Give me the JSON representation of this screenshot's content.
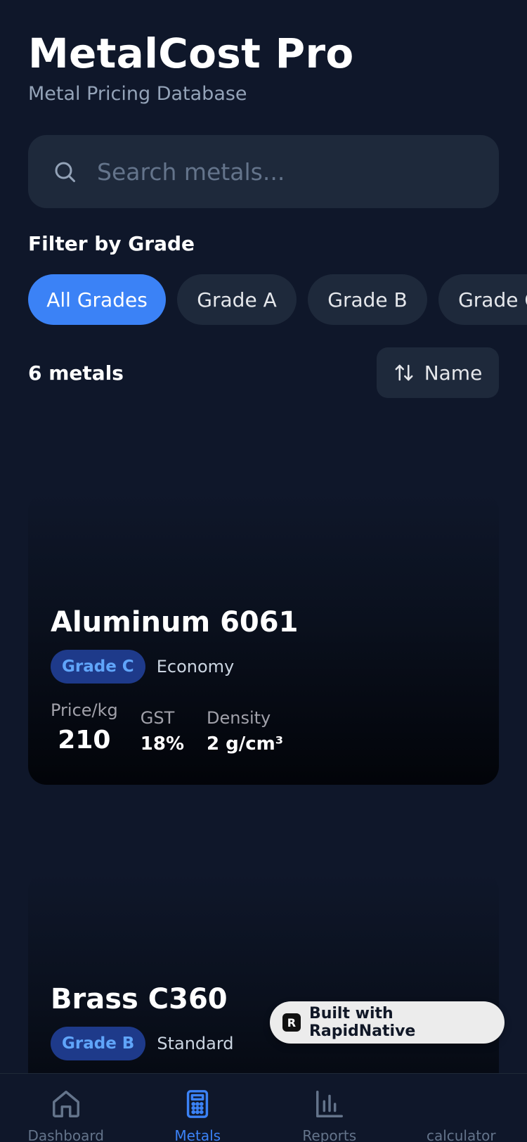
{
  "header": {
    "title": "MetalCost Pro",
    "subtitle": "Metal Pricing Database"
  },
  "search": {
    "placeholder": "Search metals...",
    "value": "",
    "icon": "search-icon"
  },
  "filter": {
    "label": "Filter by Grade",
    "chips": [
      "All Grades",
      "Grade A",
      "Grade B",
      "Grade C"
    ],
    "active": "All Grades"
  },
  "results": {
    "count": "6 metals",
    "sort_label": "Name",
    "sort_icon": "sort-arrows-icon"
  },
  "cards": [
    {
      "name": "Aluminum 6061",
      "grade": "Grade C",
      "tier": "Economy",
      "price_label": "Price/kg",
      "price": "210",
      "gst_label": "GST",
      "gst": "18%",
      "density_label": "Density",
      "density": "2 g/cm³"
    },
    {
      "name": "Brass C360",
      "grade": "Grade B",
      "tier": "Standard"
    }
  ],
  "badge": {
    "label": "Built with RapidNative",
    "logo": "R"
  },
  "tabs": [
    {
      "label": "Dashboard",
      "icon": "home-icon"
    },
    {
      "label": "Metals",
      "icon": "calculator-icon"
    },
    {
      "label": "Reports",
      "icon": "bar-chart-icon"
    },
    {
      "label": "calculator",
      "icon": "calculator-icon"
    }
  ],
  "colors": {
    "background": "#0f172a",
    "surface": "#1e293b",
    "accent": "#3b82f6",
    "badge_bg": "#1e3a8a",
    "badge_text": "#60a5fa"
  }
}
